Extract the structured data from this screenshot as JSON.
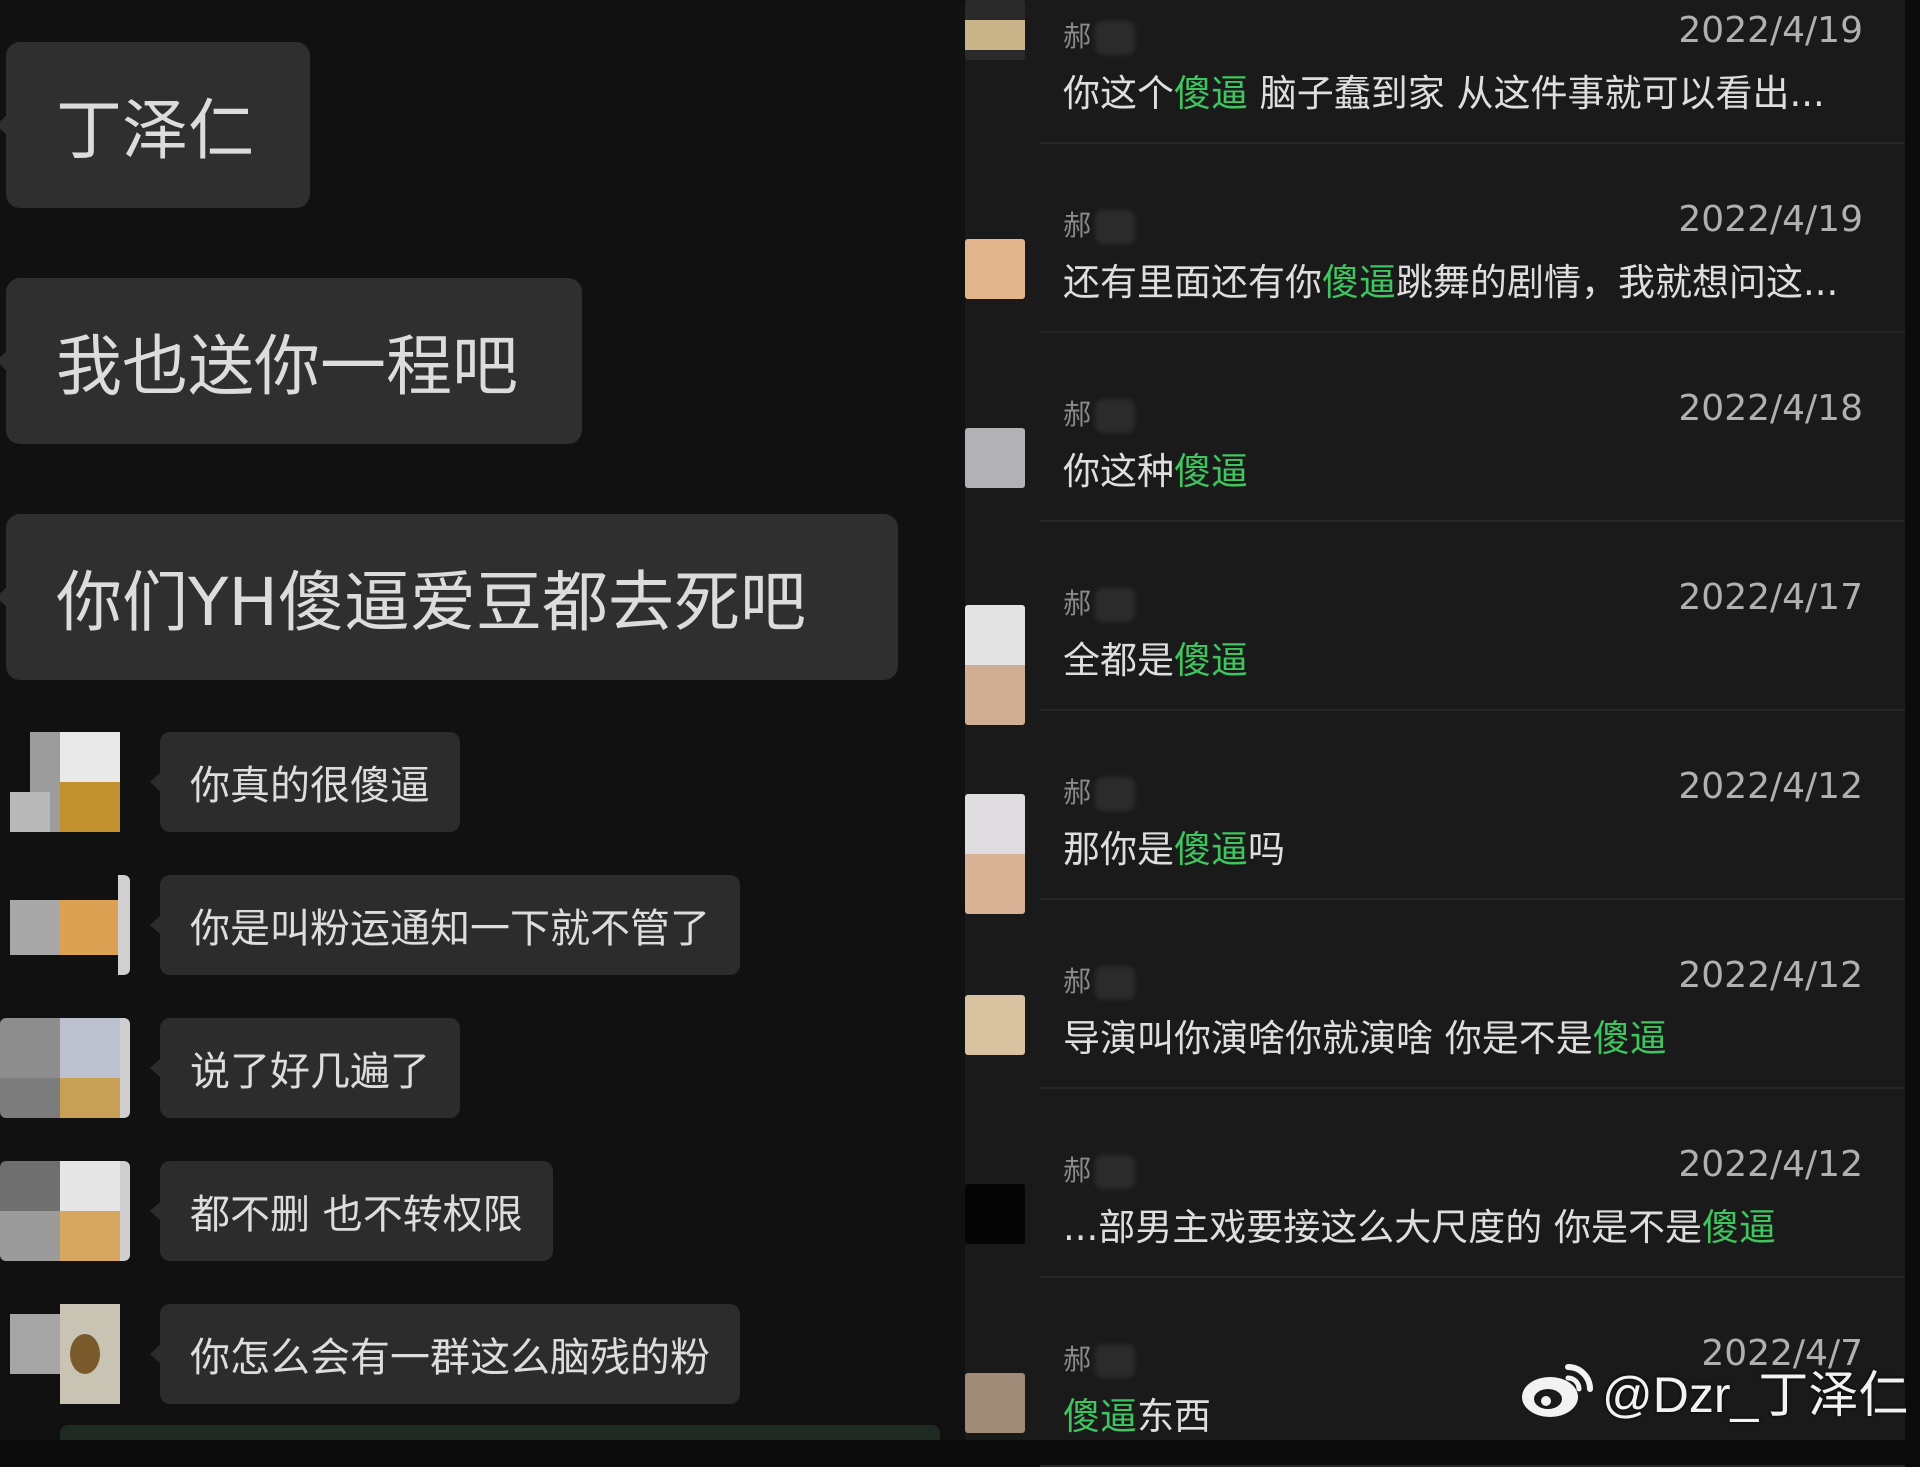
{
  "left_panel": {
    "big_messages": [
      "丁泽仁",
      "我也送你一程吧",
      "你们YH傻逼爱豆都去死吧"
    ],
    "messages": [
      "你真的很傻逼",
      "你是叫粉运通知一下就不管了",
      "说了好几遍了",
      "都不删 也不转权限",
      "你怎么会有一群这么脑残的粉"
    ]
  },
  "right_panel": {
    "comments": [
      {
        "user": "郝",
        "date": "2022/4/19",
        "pre": "你这个",
        "hl": "傻逼",
        "post": " 脑子蠢到家 从这件事就可以看出..."
      },
      {
        "user": "郝",
        "date": "2022/4/19",
        "pre": "还有里面还有你",
        "hl": "傻逼",
        "post": "跳舞的剧情，我就想问这..."
      },
      {
        "user": "郝",
        "date": "2022/4/18",
        "pre": "你这种",
        "hl": "傻逼",
        "post": ""
      },
      {
        "user": "郝",
        "date": "2022/4/17",
        "pre": "全都是",
        "hl": "傻逼",
        "post": ""
      },
      {
        "user": "郝",
        "date": "2022/4/12",
        "pre": "那你是",
        "hl": "傻逼",
        "post": "吗"
      },
      {
        "user": "郝",
        "date": "2022/4/12",
        "pre": "导演叫你演啥你就演啥 你是不是",
        "hl": "傻逼",
        "post": ""
      },
      {
        "user": "郝",
        "date": "2022/4/12",
        "pre": "...部男主戏要接这么大尺度的 你是不是",
        "hl": "傻逼",
        "post": ""
      },
      {
        "user": "郝",
        "date": "2022/4/7",
        "pre": "",
        "hl": "傻逼",
        "post": "东西"
      }
    ]
  },
  "watermark": {
    "text": "@Dzr_丁泽仁",
    "icon": "weibo-logo-icon"
  },
  "colors": {
    "highlight": "#3fc45f",
    "bubble": "#2f2f2f",
    "panel_right": "#1a1a1a"
  }
}
